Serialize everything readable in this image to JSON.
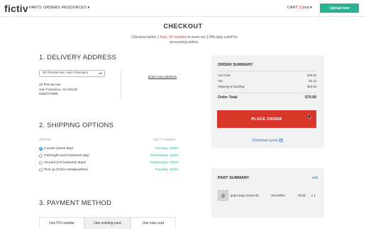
{
  "nav": {
    "logo": "fictiv",
    "links": [
      "PARTS",
      "ORDERS",
      "RESOURCES ▾"
    ],
    "cart_label": "CART",
    "cart_count": "(1)",
    "user_menu": "Ina ▾",
    "upload_label": "Upload new"
  },
  "page": {
    "title": "CHECKOUT",
    "cutoff_prefix": "Checkout within",
    "cutoff_time": "1 hour, 55 minutes",
    "cutoff_suffix": "to meet our 3 PM daily cutoff for processing orders."
  },
  "delivery": {
    "title": "1. DELIVERY ADDRESS",
    "selected_address": "22 Precita Ave, San Francisco",
    "address_lines": [
      "22 Precita Ave",
      "San Francisco, CA 94110",
      "6262727585"
    ],
    "enter_new": "Enter new address"
  },
  "shipping": {
    "title": "2. SHIPPING OPTIONS",
    "col_option": "OPTION",
    "col_date": "GET IT WHEN?",
    "options": [
      {
        "label": "Courier (same day)",
        "date": "Tuesday, 03/28",
        "selected": true
      },
      {
        "label": "Overnight (next business day)",
        "date": "Wednesday, 03/29",
        "selected": false
      },
      {
        "label": "Ground (3-5 business days)",
        "date": "Wednesday, 03/29",
        "selected": false
      },
      {
        "label": "Pick up (Fictiv Headquarters)",
        "date": "Tuesday, 03/28",
        "selected": false
      }
    ]
  },
  "payment": {
    "title": "3. PAYMENT METHOD",
    "tabs": [
      "Use PO number",
      "Use existing card",
      "Use new card"
    ],
    "active_tab": "Use existing card"
  },
  "order_summary": {
    "title": "ORDER SUMMARY",
    "rows": [
      {
        "label": "Cart total:",
        "value": "$48.55"
      },
      {
        "label": "Tax:",
        "value": "$4.13"
      },
      {
        "label": "Shipping & handling:",
        "value": "$18.00"
      }
    ],
    "total_label": "Order Total",
    "total_value": "$70.68",
    "place_order": "PLACE ORDER",
    "download_quote": "Download quote"
  },
  "part_summary": {
    "title": "PART SUMMARY",
    "edit": "edit",
    "parts": [
      {
        "name": "gopro-lego-mount.stl",
        "material": "VeroWhite",
        "price": "48.55",
        "qty": "x 1"
      }
    ]
  },
  "colors": {
    "accent_green": "#27b294",
    "place_order_red": "#d9362b",
    "link_blue": "#1c7bd7",
    "panel_gray": "#f2f2f2"
  }
}
